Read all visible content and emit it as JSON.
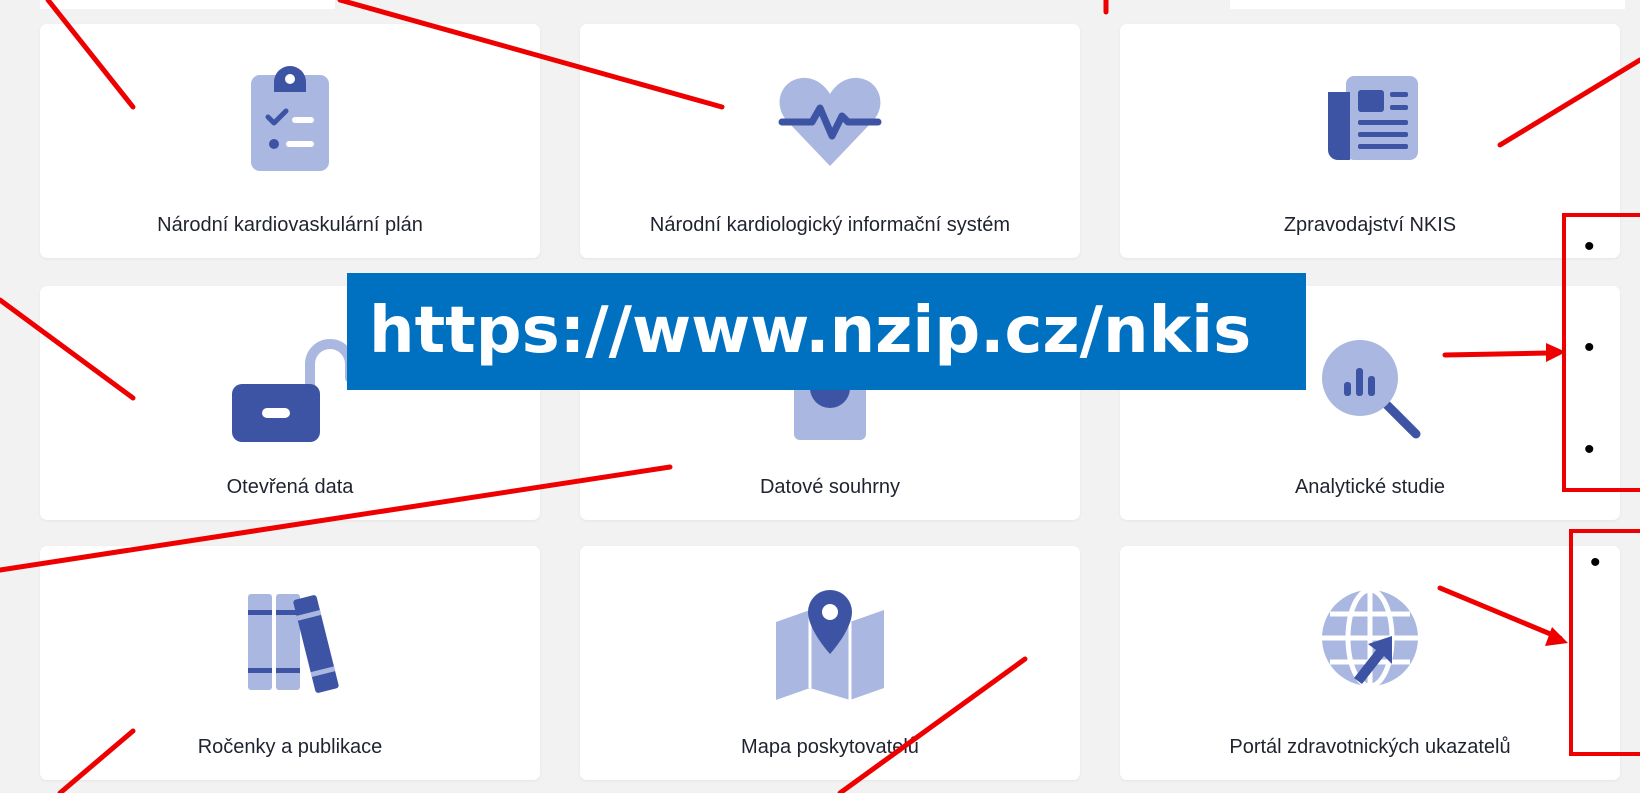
{
  "url_banner": "https://www.nzip.cz/nkis",
  "cards": [
    {
      "label": "Národní kardiovaskulární plán",
      "icon": "clipboard-checklist-icon"
    },
    {
      "label": "Národní kardiologický informační systém",
      "icon": "heart-pulse-icon"
    },
    {
      "label": "Zpravodajství NKIS",
      "icon": "newspaper-icon"
    },
    {
      "label": "Otevřená data",
      "icon": "unlocked-padlock-icon"
    },
    {
      "label": "Datové souhrny",
      "icon": "pie-chart-icon"
    },
    {
      "label": "Analytické studie",
      "icon": "magnifier-bar-chart-icon"
    },
    {
      "label": "Ročenky a publikace",
      "icon": "books-icon"
    },
    {
      "label": "Mapa poskytovatelů",
      "icon": "map-pin-icon"
    },
    {
      "label": "Portál zdravotnických ukazatelů",
      "icon": "globe-cursor-icon"
    }
  ],
  "bullets": [
    "•",
    "•",
    "•",
    "•"
  ],
  "colors": {
    "icon_dark": "#3d54a5",
    "icon_light": "#aab7e0",
    "banner": "#0070c0",
    "annotation_red": "#ee0000",
    "background": "#f2f2f3"
  }
}
